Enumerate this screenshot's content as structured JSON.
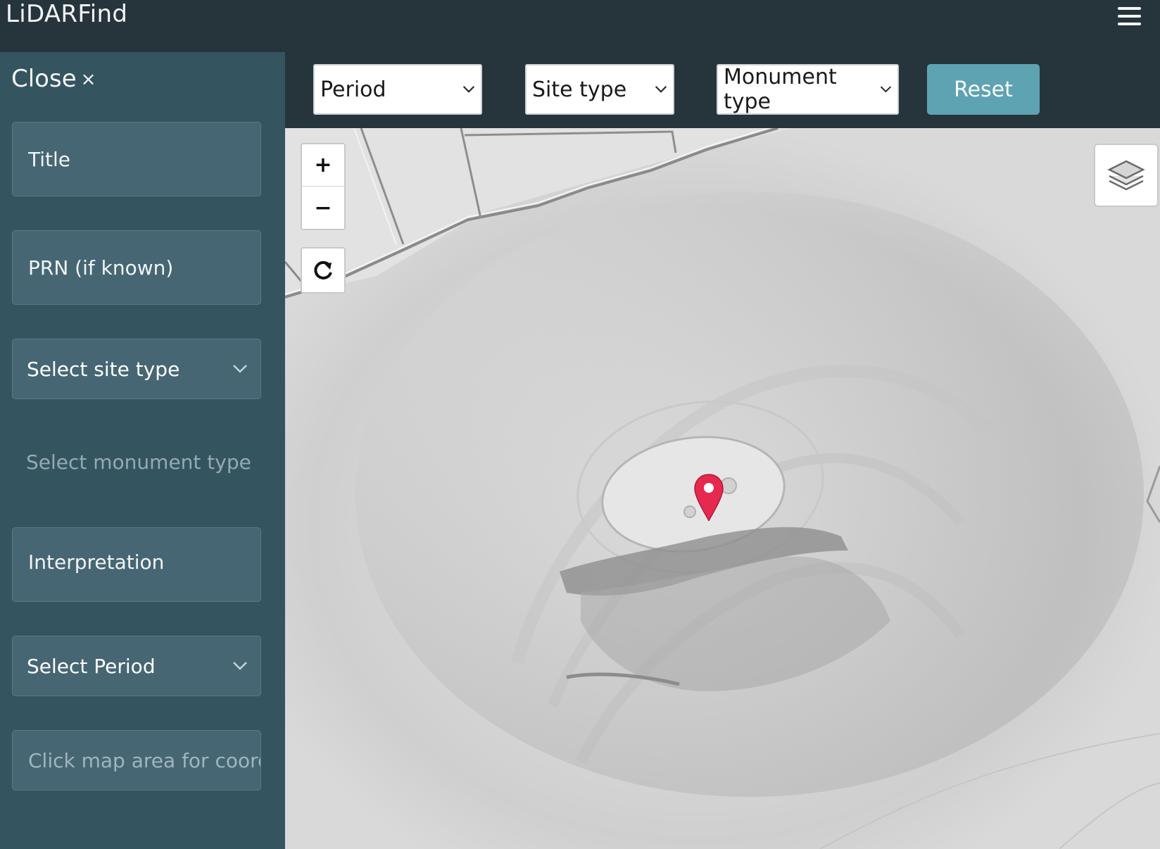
{
  "header": {
    "title": "LiDARFind",
    "menu_icon": "hamburger-menu-icon"
  },
  "sidebar": {
    "close_label": "Close",
    "close_glyph": "×",
    "title_placeholder": "Title",
    "prn_placeholder": "PRN (if known)",
    "site_type_label": "Select site type",
    "monument_type_label": "Select monument type",
    "interpretation_placeholder": "Interpretation",
    "period_label": "Select Period",
    "coords_placeholder": "Click map area for coordinates"
  },
  "filters": {
    "period": "Period",
    "site_type": "Site type",
    "monument_type": "Monument type",
    "reset": "Reset"
  },
  "map": {
    "zoom_in": "+",
    "zoom_out": "−",
    "refresh_icon": "refresh-icon",
    "layers_icon": "layers-icon",
    "marker_icon": "map-marker-icon"
  },
  "colors": {
    "header_bg": "#26343c",
    "sidebar_bg": "#345560",
    "field_bg": "#466673",
    "reset_bg": "#5ea3b2",
    "marker": "#e5294f"
  }
}
